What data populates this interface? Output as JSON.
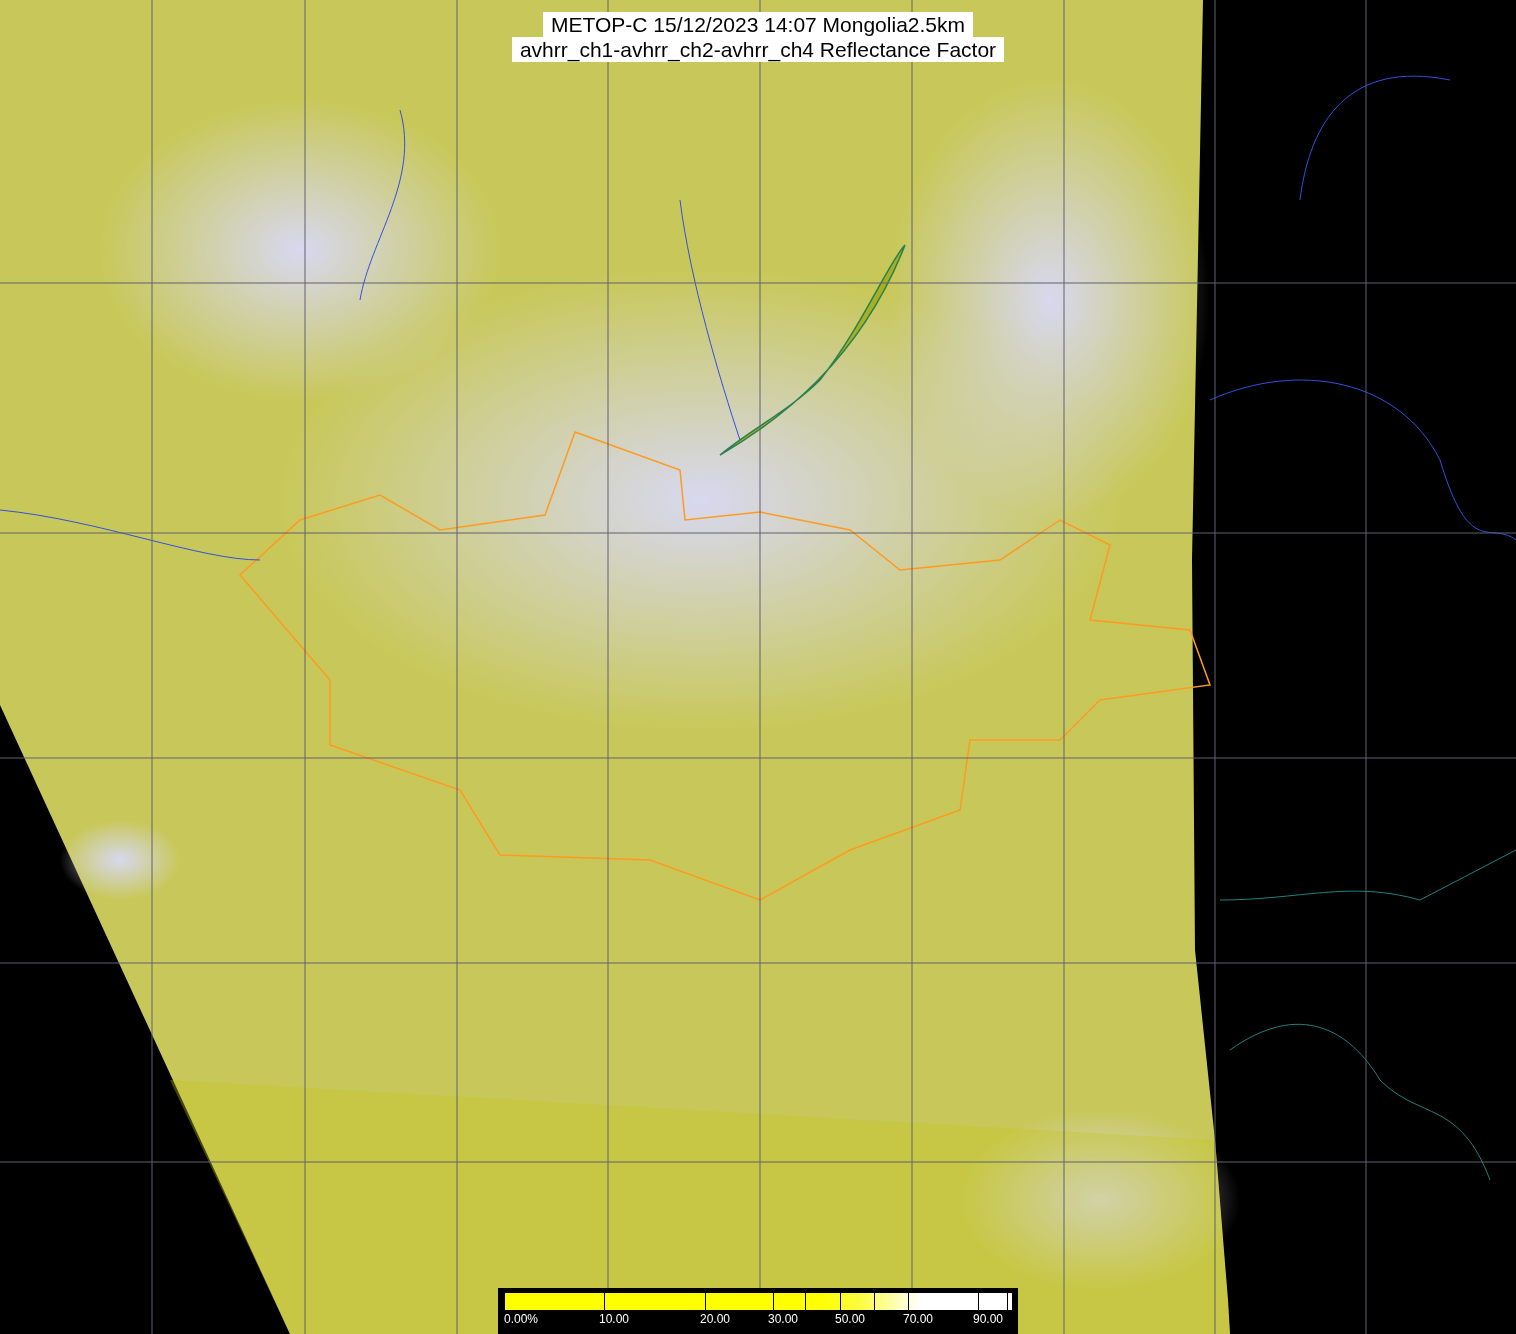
{
  "title": {
    "lines": [
      "METOP-C 15/12/2023 14:07 Mongolia2.5km",
      "avhrr_ch1-avhrr_ch2-avhrr_ch4 Reflectance Factor"
    ]
  },
  "colorbar": {
    "labels": [
      "0.00%",
      "10.00",
      "20.00",
      "30.00",
      "50.00",
      "70.00",
      "90.00"
    ]
  }
}
